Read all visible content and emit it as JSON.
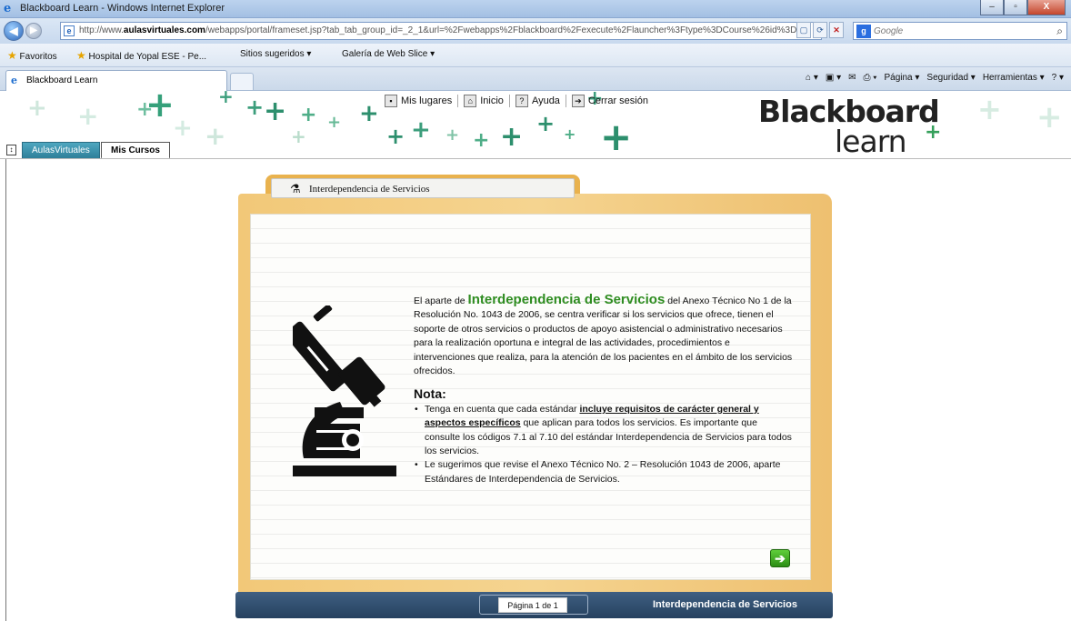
{
  "window": {
    "title": "Blackboard Learn - Windows Internet Explorer",
    "minimize": "–",
    "maximize": "▫",
    "close": "X"
  },
  "address_bar": {
    "url_prefix": "http://www.",
    "url_domain": "aulasvirtuales.com",
    "url_rest": "/webapps/portal/frameset.jsp?tab_tab_group_id=_2_1&url=%2Fwebapps%2Fblackboard%2Fexecute%2Flauncher%3Ftype%3DCourse%26id%3D_1",
    "search_placeholder": "Google"
  },
  "favorites_bar": {
    "favorites_label": "Favoritos",
    "items": [
      "Hospital de Yopal ESE - Pe...",
      "Sitios sugeridos ▾",
      "Galería de Web Slice ▾"
    ]
  },
  "browser_tab": {
    "label": "Blackboard Learn"
  },
  "command_bar": {
    "items": [
      "Página ▾",
      "Seguridad ▾",
      "Herramientas ▾"
    ]
  },
  "bb_header": {
    "links": [
      "Mis lugares",
      "Inicio",
      "Ayuda",
      "Cerrar sesión"
    ],
    "logo_line1": "Blackboard",
    "logo_line2": "learn",
    "tabs": [
      "AulasVirtuales",
      "Mis Cursos"
    ]
  },
  "module": {
    "tab_title": "Interdependencia de Servicios",
    "intro_before": "El aparte de ",
    "intro_highlight": "Interdependencia de Servicios",
    "intro_after": " del Anexo Técnico No 1 de la Resolución No. 1043 de 2006, se centra verificar si los servicios que ofrece, tienen el soporte de otros servicios o productos de apoyo asistencial o administrativo necesarios para la realización oportuna e integral de las actividades, procedimientos e intervenciones que realiza, para la atención de los pacientes en el ámbito de los servicios ofrecidos.",
    "nota_title": "Nota:",
    "bullet1_before": "Tenga en cuenta que cada estándar ",
    "bullet1_bold": "incluye requisitos de carácter general y aspectos específicos",
    "bullet1_after": " que aplican para todos los servicios. Es importante que consulte los códigos 7.1 al 7.10 del estándar Interdependencia de Servicios para todos los servicios.",
    "bullet2": "Le sugerimos que revise el Anexo Técnico No. 2 – Resolución 1043 de 2006, aparte Estándares de Interdependencia de Servicios.",
    "next_icon": "arrow-right-icon",
    "page_indicator": "Página 1 de 1",
    "footer_title": "Interdependencia de Servicios"
  },
  "colors": {
    "accent_green": "#2f8d21",
    "folder": "#f2c878",
    "footer_bar": "#2f4c6e",
    "tab_blue": "#3b8fab"
  }
}
